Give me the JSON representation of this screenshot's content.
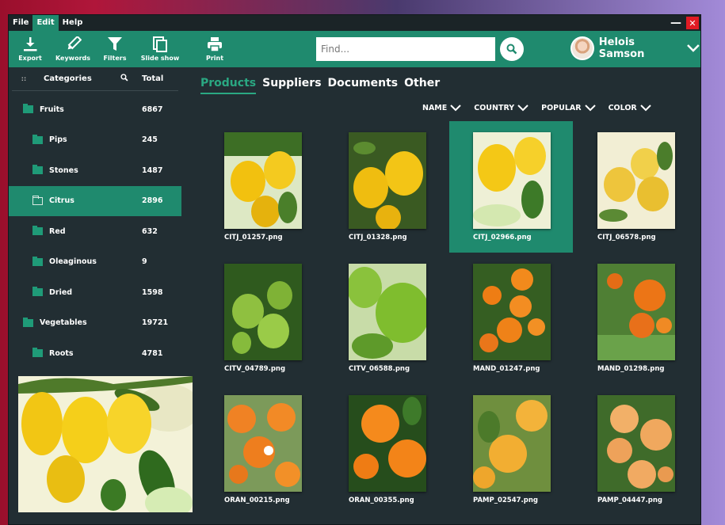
{
  "menu": {
    "file": "File",
    "edit": "Edit",
    "help": "Help"
  },
  "window_controls": {
    "minimize": "—",
    "close": "✕"
  },
  "toolbar": {
    "export": "Export",
    "keywords": "Keywords",
    "filters": "Filters",
    "slideshow": "Slide show",
    "print": "Print"
  },
  "search": {
    "placeholder": "Find..."
  },
  "user": {
    "name": "Helois Samson"
  },
  "sidebar": {
    "header": {
      "categories": "Categories",
      "total": "Total"
    },
    "items": [
      {
        "label": "Fruits",
        "count": "6867"
      },
      {
        "label": "Pips",
        "count": "245"
      },
      {
        "label": "Stones",
        "count": "1487"
      },
      {
        "label": "Citrus",
        "count": "2896"
      },
      {
        "label": "Red",
        "count": "632"
      },
      {
        "label": "Oleaginous",
        "count": "9"
      },
      {
        "label": "Dried",
        "count": "1598"
      },
      {
        "label": "Vegetables",
        "count": "19721"
      },
      {
        "label": "Roots",
        "count": "4781"
      }
    ]
  },
  "tabs": [
    "Products",
    "Suppliers",
    "Documents",
    "Other"
  ],
  "sort": [
    "NAME",
    "COUNTRY",
    "POPULAR",
    "COLOR"
  ],
  "colors": {
    "accent": "#1f8a6e",
    "background": "#222e33",
    "close": "#e11b24"
  },
  "files": [
    "CITJ_01257.png",
    "CITJ_01328.png",
    "CITJ_02966.png",
    "CITJ_06578.png",
    "CITV_04789.png",
    "CITV_06588.png",
    "MAND_01247.png",
    "MAND_01298.png",
    "ORAN_00215.png",
    "ORAN_00355.png",
    "PAMP_02547.png",
    "PAMP_04447.png"
  ]
}
